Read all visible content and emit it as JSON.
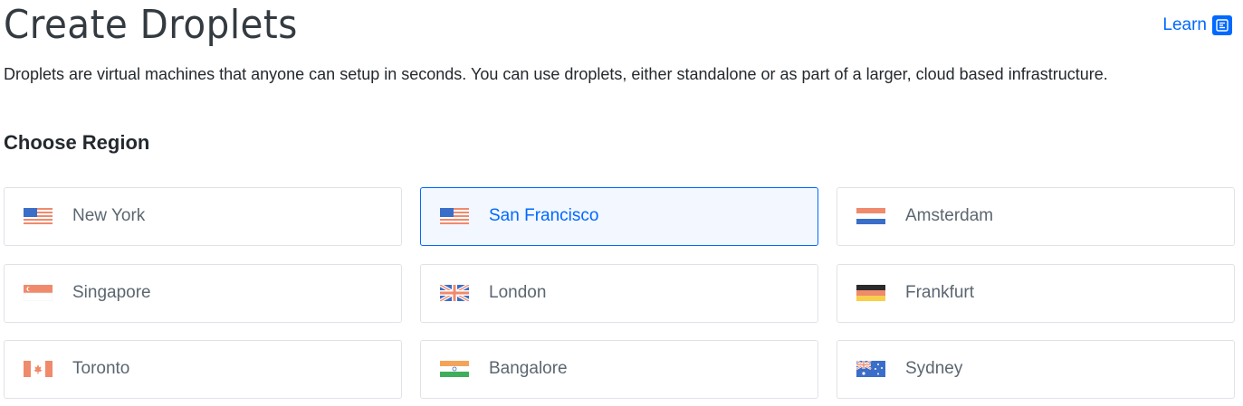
{
  "header": {
    "title": "Create Droplets",
    "learn_label": "Learn",
    "learn_icon": "document-icon"
  },
  "description": "Droplets are virtual machines that anyone can setup in seconds. You can use droplets, either standalone or as part of a larger, cloud based infrastructure.",
  "regions": {
    "title": "Choose Region",
    "selected": "San Francisco",
    "items": [
      {
        "label": "New York",
        "flag": "us-flag-icon"
      },
      {
        "label": "San Francisco",
        "flag": "us-flag-icon"
      },
      {
        "label": "Amsterdam",
        "flag": "netherlands-flag-icon"
      },
      {
        "label": "Singapore",
        "flag": "singapore-flag-icon"
      },
      {
        "label": "London",
        "flag": "uk-flag-icon"
      },
      {
        "label": "Frankfurt",
        "flag": "germany-flag-icon"
      },
      {
        "label": "Toronto",
        "flag": "canada-flag-icon"
      },
      {
        "label": "Bangalore",
        "flag": "india-flag-icon"
      },
      {
        "label": "Sydney",
        "flag": "australia-flag-icon"
      }
    ]
  },
  "colors": {
    "accent": "#0069ff",
    "selected_bg": "#f3f7ff",
    "card_border": "#dfe3e8",
    "label_text": "#5b6670"
  }
}
